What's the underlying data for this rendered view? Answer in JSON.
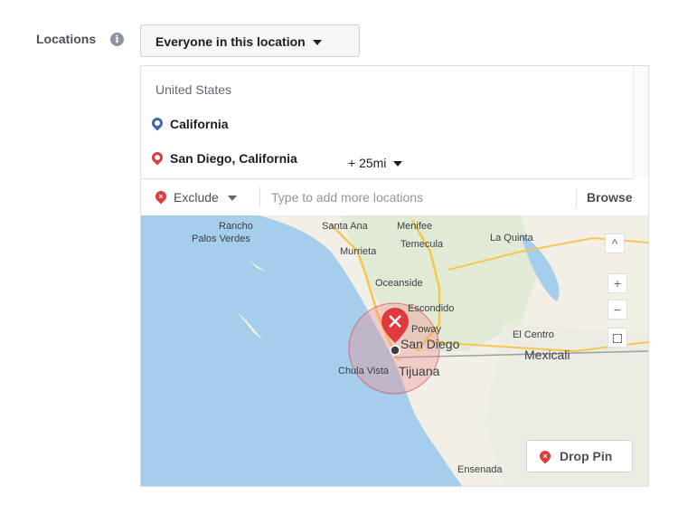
{
  "locations_label": "Locations",
  "info_icon": "info-icon",
  "audience_dropdown": {
    "value": "Everyone in this location"
  },
  "included": {
    "country": "United States",
    "items": [
      {
        "name": "California",
        "pin_color": "#4267b2"
      },
      {
        "name": "San Diego, California",
        "pin_color": "#e0393e",
        "radius": "+ 25mi"
      }
    ]
  },
  "exclude_dropdown": {
    "value": "Exclude"
  },
  "location_search": {
    "placeholder": "Type to add more locations",
    "value": ""
  },
  "browse_label": "Browse",
  "map": {
    "labels": {
      "rancho": "Rancho",
      "palos_verdes": "Palos Verdes",
      "santa_ana": "Santa Ana",
      "menifee": "Menifee",
      "murrieta": "Murrieta",
      "temecula": "Temecula",
      "la_quinta": "La Quinta",
      "oceanside": "Oceanside",
      "escondido": "Escondido",
      "poway": "Poway",
      "san_diego": "San Diego",
      "el_centro": "El Centro",
      "mexicali": "Mexicali",
      "chula_vista": "Chula Vista",
      "tijuana": "Tijuana",
      "ensenada": "Ensenada"
    },
    "controls": {
      "collapse": "^",
      "zoom_in": "+",
      "zoom_out": "−",
      "recenter": "recenter-icon"
    },
    "drop_pin_label": "Drop Pin",
    "colors": {
      "water": "#a5cdec",
      "land": "#f2efe6",
      "radius_fill": "#f08b8b",
      "pin": "#e0393e"
    }
  }
}
